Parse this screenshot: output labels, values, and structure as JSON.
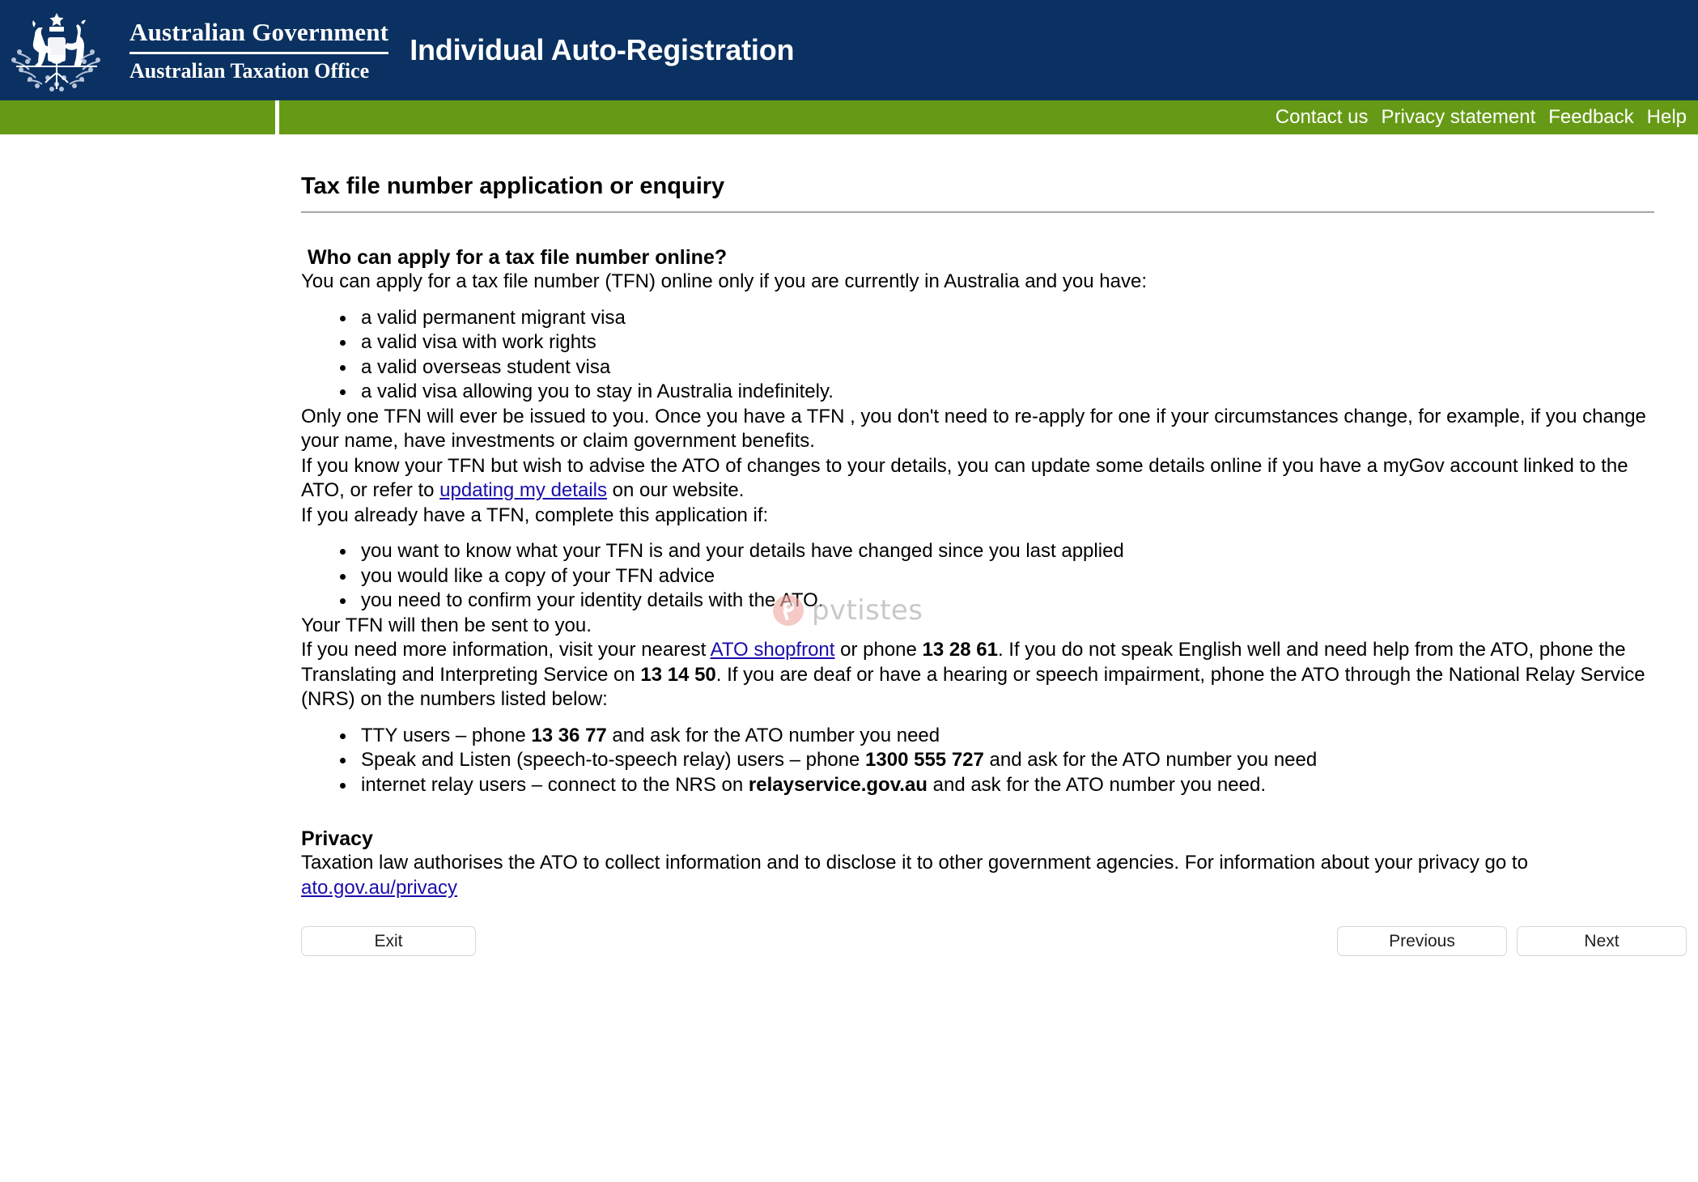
{
  "header": {
    "crest_icon": "australian-coat-of-arms",
    "gov_line1": "Australian Government",
    "gov_line2": "Australian Taxation Office",
    "app_title": "Individual Auto-Registration",
    "background_color": "#0a3161"
  },
  "navbar": {
    "background_color": "#669a16",
    "links": [
      {
        "label": "Contact us"
      },
      {
        "label": "Privacy statement"
      },
      {
        "label": "Feedback"
      },
      {
        "label": "Help"
      }
    ]
  },
  "main": {
    "page_title": "Tax file number application or enquiry",
    "section_question": "Who can apply for a tax file number online?",
    "intro_paragraph": "You can apply for a tax file number (TFN) online only if you are currently in Australia and you have:",
    "eligibility_bullets": [
      "a valid permanent migrant visa",
      "a valid visa with work rights",
      "a valid overseas student visa",
      "a valid visa allowing you to stay in Australia indefinitely."
    ],
    "para_one_tfn": "Only one TFN will ever be issued to you. Once you have a TFN , you don't need to re-apply for one if your circumstances change, for example, if you change your name, have investments or claim government benefits.",
    "para_know_tfn_part1": "If you know your TFN but wish to advise the ATO of changes to your details, you can update some details online if you have a myGov account linked to the ATO, or refer to ",
    "para_know_tfn_link": "updating my details",
    "para_know_tfn_part2": " on our website.",
    "para_already_have": "If you already have a TFN, complete this application if:",
    "already_have_bullets": [
      "you want to know what your TFN is and your details have changed since you last applied",
      "you would like a copy of your TFN advice",
      "you need to confirm your identity details with the ATO."
    ],
    "para_tfn_sent": "Your TFN will then be sent to you.",
    "para_more_info_p1": "If you need more information, visit your nearest ",
    "para_more_info_link": "ATO shopfront",
    "para_more_info_p2": " or phone ",
    "phone_ato": "13 28 61",
    "para_more_info_p3": ". If you do not speak English well and need help from the ATO, phone the Translating and Interpreting Service on ",
    "phone_tis": "13 14 50",
    "para_more_info_p4": ". If you are deaf or have a hearing or speech impairment, phone the ATO through the National Relay Service (NRS) on the numbers listed below:",
    "relay_bullets": [
      {
        "pre": "TTY users – phone ",
        "bold": "13 36 77",
        "post": " and ask for the ATO number you need"
      },
      {
        "pre": "Speak and Listen (speech-to-speech relay) users – phone ",
        "bold": "1300 555 727",
        "post": " and ask for the ATO number you need"
      },
      {
        "pre": "internet relay users – connect to the NRS on ",
        "bold": "relayservice.gov.au",
        "post": " and ask for the ATO number you need."
      }
    ],
    "privacy_heading": "Privacy",
    "privacy_text": "Taxation law authorises the ATO to collect information and to disclose it to other government agencies. For information about your privacy go to ",
    "privacy_link": "ato.gov.au/privacy"
  },
  "footer": {
    "exit_label": "Exit",
    "previous_label": "Previous",
    "next_label": "Next"
  },
  "watermark": {
    "text": "pvtistes",
    "logo_icon": "pvtistes-pin-logo",
    "logo_color": "#f0a9a2",
    "text_color": "#a8a8a8"
  }
}
